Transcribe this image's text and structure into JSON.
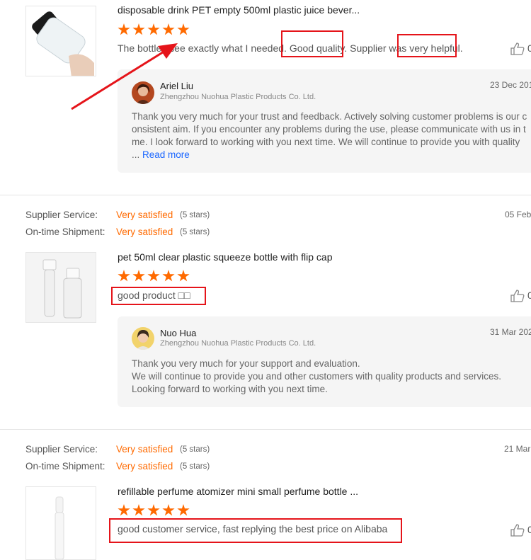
{
  "reviews": [
    {
      "product_title": "disposable drink PET empty 500ml plastic juice bever...",
      "review_text": "The bottles see exactly what I needed. Good quality. Supplier was very helpful.",
      "like_count": "0",
      "rating_stars": 5,
      "reply": {
        "name": "Ariel Liu",
        "company": "Zhengzhou Nuohua Plastic Products Co. Ltd.",
        "date": "23 Dec 201",
        "lines": [
          "Thank you very much for your trust and feedback. Actively solving customer problems is our c",
          "onsistent aim. If you encounter any problems during the use, please communicate with us in t",
          "me. I look forward to working with you next time. We will continue to provide you with quality"
        ],
        "ellipsis": "...",
        "read_more": "Read more"
      }
    },
    {
      "supplier_service_label": "Supplier Service:",
      "supplier_service_value": "Very satisfied",
      "supplier_service_stars": "(5 stars)",
      "shipment_label": "On-time Shipment:",
      "shipment_value": "Very satisfied",
      "shipment_stars": "(5 stars)",
      "order_date": "05 Feb",
      "product_title": "pet 50ml clear plastic squeeze bottle with flip cap",
      "review_text": "good product □□",
      "like_count": "0",
      "rating_stars": 5,
      "reply": {
        "name": "Nuo Hua",
        "company": "Zhengzhou Nuohua Plastic Products Co. Ltd.",
        "date": "31 Mar 202",
        "lines": [
          "Thank you very much for your support and evaluation.",
          "We will continue to provide you and other customers with quality products and services.",
          "Looking forward to working with you next time."
        ]
      }
    },
    {
      "supplier_service_label": "Supplier Service:",
      "supplier_service_value": "Very satisfied",
      "supplier_service_stars": "(5 stars)",
      "shipment_label": "On-time Shipment:",
      "shipment_value": "Very satisfied",
      "shipment_stars": "(5 stars)",
      "order_date": "21 Mar",
      "product_title": "refillable perfume atomizer mini small perfume bottle ...",
      "review_text": "good customer service, fast replying the best price on Alibaba",
      "like_count": "0",
      "rating_stars": 5
    }
  ],
  "colors": {
    "accent_orange": "#ff6a00",
    "annotation_red": "#e5141a",
    "link_blue": "#1a66ff"
  }
}
